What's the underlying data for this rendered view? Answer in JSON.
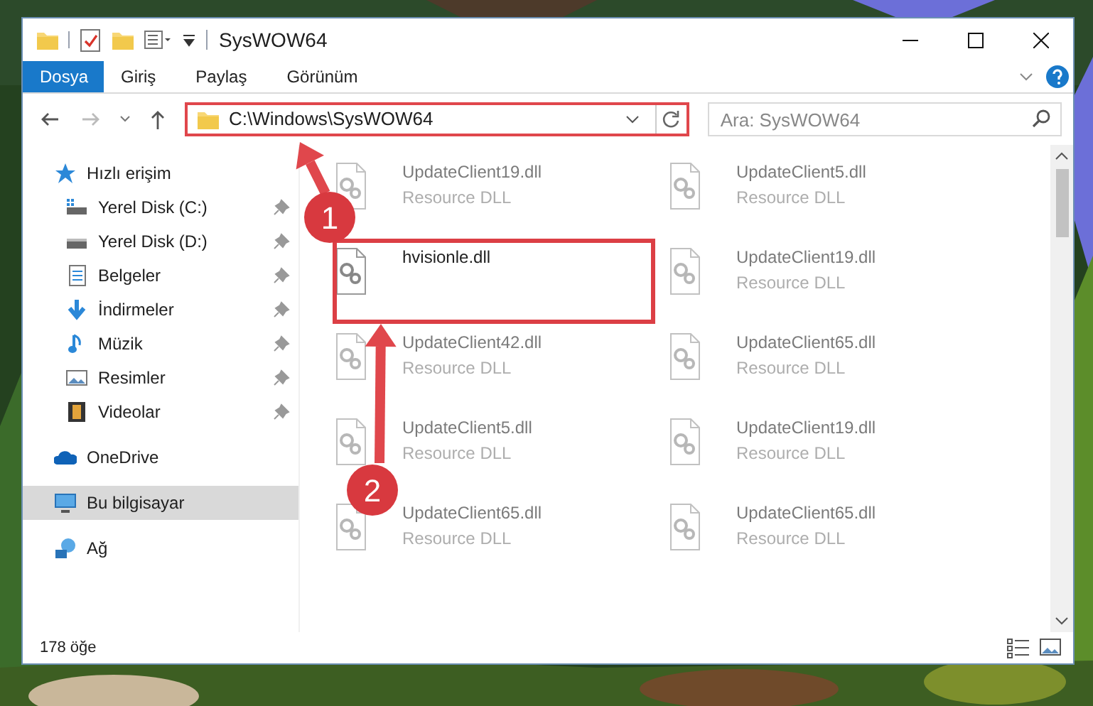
{
  "window": {
    "title": "SysWOW64"
  },
  "ribbon_tabs": [
    {
      "label": "Dosya",
      "selected": true
    },
    {
      "label": "Giriş",
      "selected": false
    },
    {
      "label": "Paylaş",
      "selected": false
    },
    {
      "label": "Görünüm",
      "selected": false
    }
  ],
  "address_bar": {
    "value": "C:\\Windows\\SysWOW64"
  },
  "search": {
    "placeholder": "Ara: SysWOW64"
  },
  "sidebar": {
    "items": [
      {
        "label": "Hızlı erişim",
        "kind": "star",
        "pinned": false,
        "selected": false,
        "children": [
          {
            "label": "Yerel Disk (C:)",
            "kind": "drive-c",
            "pinned": true,
            "selected": false
          },
          {
            "label": "Yerel Disk (D:)",
            "kind": "drive",
            "pinned": true,
            "selected": false
          },
          {
            "label": "Belgeler",
            "kind": "document",
            "pinned": true,
            "selected": false
          },
          {
            "label": "İndirmeler",
            "kind": "download",
            "pinned": true,
            "selected": false
          },
          {
            "label": "Müzik",
            "kind": "music",
            "pinned": true,
            "selected": false
          },
          {
            "label": "Resimler",
            "kind": "pictures",
            "pinned": true,
            "selected": false
          },
          {
            "label": "Videolar",
            "kind": "videos",
            "pinned": true,
            "selected": false
          }
        ]
      },
      {
        "label": "OneDrive",
        "kind": "cloud",
        "pinned": false,
        "selected": false
      },
      {
        "label": "Bu bilgisayar",
        "kind": "computer",
        "pinned": false,
        "selected": true
      },
      {
        "label": "Ağ",
        "kind": "network",
        "pinned": false,
        "selected": false
      }
    ]
  },
  "files": [
    {
      "name": "UpdateClient19.dll",
      "type": "Resource DLL",
      "faded": true
    },
    {
      "name": "UpdateClient5.dll",
      "type": "Resource DLL",
      "faded": true
    },
    {
      "name": "hvisionle.dll",
      "faded": false
    },
    {
      "name": "UpdateClient19.dll",
      "type": "Resource DLL",
      "faded": true
    },
    {
      "name": "UpdateClient42.dll",
      "type": "Resource DLL",
      "faded": true
    },
    {
      "name": "UpdateClient65.dll",
      "type": "Resource DLL",
      "faded": true
    },
    {
      "name": "UpdateClient5.dll",
      "type": "Resource DLL",
      "faded": true
    },
    {
      "name": "UpdateClient19.dll",
      "type": "Resource DLL",
      "faded": true
    },
    {
      "name": "UpdateClient65.dll",
      "type": "Resource DLL",
      "faded": true
    },
    {
      "name": "UpdateClient65.dll",
      "type": "Resource DLL",
      "faded": true
    }
  ],
  "annotations": [
    {
      "kind": "step",
      "label": "1"
    },
    {
      "kind": "step",
      "label": "2"
    }
  ],
  "status_bar": {
    "count": "178 öğe"
  }
}
